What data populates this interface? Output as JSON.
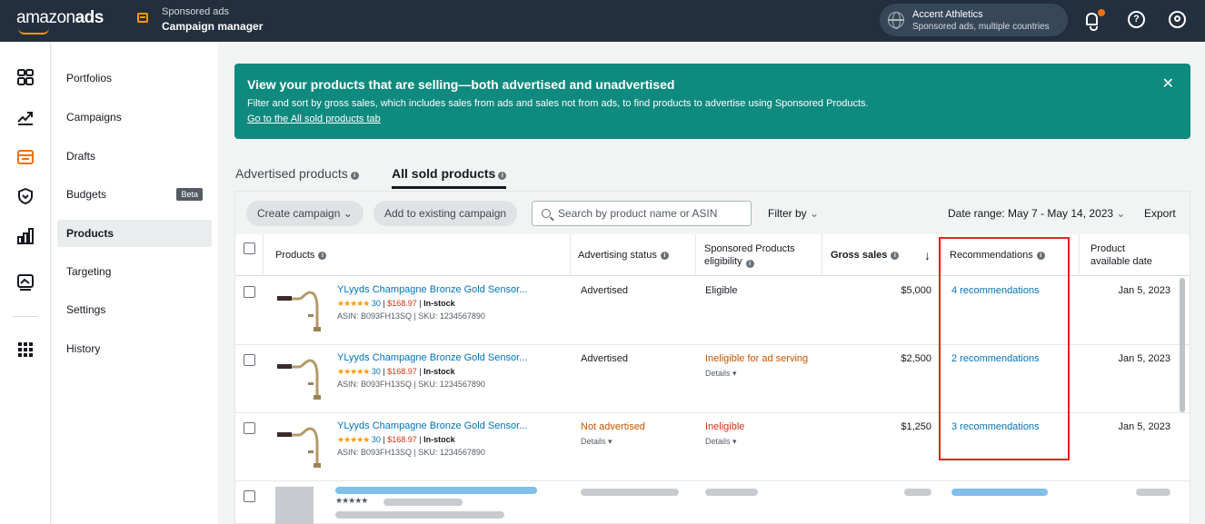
{
  "topbar": {
    "logo_regular": "amazon",
    "logo_bold": "ads",
    "product_line": "Sponsored ads",
    "product_name": "Campaign manager",
    "account_name": "Accent Athletics",
    "account_scope": "Sponsored ads, multiple countries",
    "help_glyph": "?"
  },
  "nav": {
    "items": [
      {
        "label": "Portfolios"
      },
      {
        "label": "Campaigns"
      },
      {
        "label": "Drafts"
      },
      {
        "label": "Budgets",
        "badge": "Beta"
      },
      {
        "label": "Products"
      },
      {
        "label": "Targeting"
      },
      {
        "label": "Settings"
      },
      {
        "label": "History"
      }
    ]
  },
  "banner": {
    "title": "View your products that are selling—both advertised and unadvertised",
    "description": "Filter and sort by gross sales, which includes sales from ads and sales not from ads, to find products to advertise using Sponsored Products.",
    "link": "Go to the All sold products tab",
    "close_glyph": "✕"
  },
  "tabs": [
    {
      "label": "Advertised products"
    },
    {
      "label": "All sold products"
    }
  ],
  "toolbar": {
    "create_campaign": "Create campaign",
    "add_existing": "Add to existing campaign",
    "search_placeholder": "Search by product name or ASIN",
    "filter_by": "Filter by",
    "date_range": "Date range: May 7 - May 14, 2023",
    "export": "Export"
  },
  "table": {
    "headers": {
      "products": "Products",
      "ad_status": "Advertising status",
      "sp_elig_1": "Sponsored Products",
      "sp_elig_2": "eligibility",
      "gross_sales": "Gross sales",
      "sort_glyph": "↓",
      "recommendations": "Recommendations",
      "avail_1": "Product",
      "avail_2": "available date"
    },
    "rows": [
      {
        "name": "YLyyds Champagne Bronze Gold Sensor...",
        "stars": "★★★★★",
        "reviews": "30",
        "price": "$168.97",
        "stock": "In-stock",
        "asin_sku": "ASIN: B093FH13SQ | SKU: 1234567890",
        "ad_status": "Advertised",
        "ad_status_details": "",
        "eligibility": "Eligible",
        "eligibility_details": "",
        "gross_sales": "$5,000",
        "recommendations": "4 recommendations",
        "available_date": "Jan 5, 2023"
      },
      {
        "name": "YLyyds Champagne Bronze Gold Sensor...",
        "stars": "★★★★★",
        "reviews": "30",
        "price": "$168.97",
        "stock": "In-stock",
        "asin_sku": "ASIN: B093FH13SQ | SKU: 1234567890",
        "ad_status": "Advertised",
        "ad_status_details": "",
        "eligibility": "Ineligible for ad serving",
        "eligibility_details": "Details ▾",
        "gross_sales": "$2,500",
        "recommendations": "2 recommendations",
        "available_date": "Jan 5, 2023"
      },
      {
        "name": "YLyyds Champagne Bronze Gold Sensor...",
        "stars": "★★★★★",
        "reviews": "30",
        "price": "$168.97",
        "stock": "In-stock",
        "asin_sku": "ASIN: B093FH13SQ | SKU: 1234567890",
        "ad_status": "Not advertised",
        "ad_status_details": "Details ▾",
        "eligibility": "Ineligible",
        "eligibility_details": "Details ▾",
        "gross_sales": "$1,250",
        "recommendations": "3 recommendations",
        "available_date": "Jan 5, 2023"
      }
    ],
    "placeholder_stars": "★★★★★"
  },
  "colors": {
    "topbar": "#232f3e",
    "banner": "#0f8a7e",
    "link": "#0073bb",
    "accent": "#ff9900",
    "alert_red": "#d13212",
    "warning_orange": "#c45500",
    "highlight_box": "#e4221b"
  },
  "icons": {
    "rail": [
      "dashboard-icon",
      "trend-icon",
      "campaign-manager-icon",
      "shield-icon",
      "bar-chart-icon",
      "media-icon",
      "apps-grid-icon"
    ]
  }
}
